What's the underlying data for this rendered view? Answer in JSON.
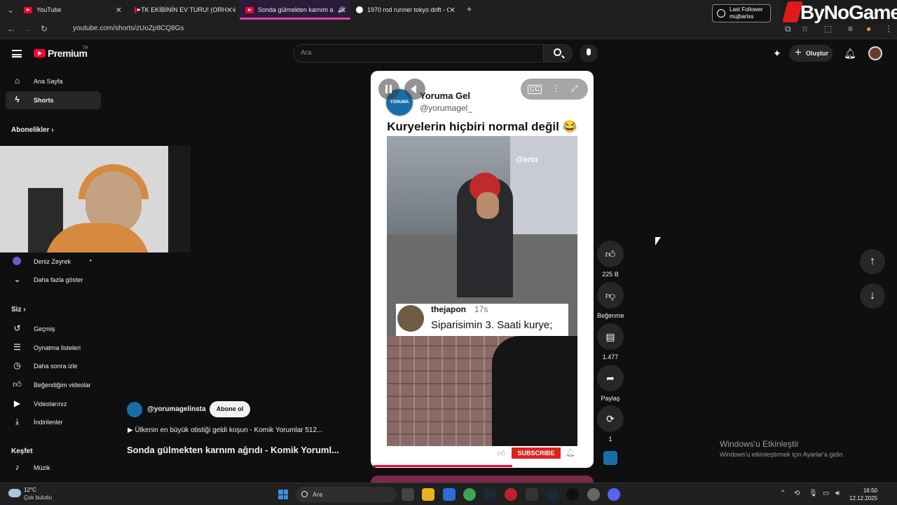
{
  "browser": {
    "tabs": [
      {
        "title": "YouTube",
        "favicon": "youtube-icon",
        "active": false
      },
      {
        "title": "TK EKİBİNİN EV TURU! (ORHAN",
        "favicon": "youtube-icon",
        "active": false
      },
      {
        "title": "Sonda gülmekten karnım a",
        "favicon": "youtube-icon",
        "active": true
      },
      {
        "title": "1970 rod runner tokyo drift - G",
        "favicon": "google-icon",
        "active": false
      }
    ],
    "new_tab": "+",
    "url": "youtube.com/shorts/zUoZp8CQ8Gs"
  },
  "overlay": {
    "last_follower_label": "Last Follower",
    "last_follower_name": "mujbariss",
    "brand": "ByNoGame"
  },
  "header": {
    "logo_text": "Premium",
    "region": "TR",
    "search_placeholder": "Ara",
    "create_label": "Oluştur"
  },
  "sidebar": {
    "main": [
      {
        "label": "Ana Sayfa",
        "icon": "home-icon"
      },
      {
        "label": "Shorts",
        "icon": "shorts-icon",
        "active": true
      }
    ],
    "subscriptions_heading": "Abonelikler",
    "subscriptions": [
      {
        "label": "Deniz Zeyrek"
      }
    ],
    "show_more": "Daha fazla göster",
    "you_heading": "Siz",
    "you_items": [
      {
        "label": "Geçmiş",
        "icon": "history-icon"
      },
      {
        "label": "Oynatma listeleri",
        "icon": "playlist-icon"
      },
      {
        "label": "Daha sonra izle",
        "icon": "clock-icon"
      },
      {
        "label": "Beğendiğim videolar",
        "icon": "thumbs-up-icon"
      },
      {
        "label": "Videolarınız",
        "icon": "video-icon"
      },
      {
        "label": "İndirilenler",
        "icon": "download-icon"
      }
    ],
    "explore_heading": "Keşfet",
    "explore_items": [
      {
        "label": "Müzik",
        "icon": "music-icon"
      }
    ]
  },
  "short": {
    "channel_name": "Yoruma Gel",
    "channel_handle": "@yorumagel_",
    "logo_text": "YORUMA GEL",
    "post_title": "Kuryelerin hiçbiri normal değil 😂",
    "watermark": "@erto",
    "comment_user": "thejapon",
    "comment_age": "17s",
    "comment_text": "Siparisimin 3. Saati kurye;",
    "subscribe_label": "SUBSCRIBE",
    "progress": 0.64
  },
  "actions": {
    "likes": "225 B",
    "dislike_label": "Beğenme",
    "comments": "1.477",
    "share_label": "Paylaş",
    "remix_count": "1"
  },
  "meta": {
    "handle": "@yorumagelinsta",
    "subscribe_label": "Abone ol",
    "link_text": "▶  Ülkenin en büyük otistiği geldi koşun - Komik Yorumlar 512...",
    "title": "Sonda gülmekten karnım ağrıdı - Komik Yoruml..."
  },
  "windows": {
    "activate_title": "Windows'u Etkinleştir",
    "activate_desc": "Windows'u etkinleştirmek için Ayarlar'a gidin.",
    "temp": "12°C",
    "weather": "Çok bulutlu",
    "search_placeholder": "Ara",
    "time": "16:50",
    "date": "12.12.2025"
  }
}
